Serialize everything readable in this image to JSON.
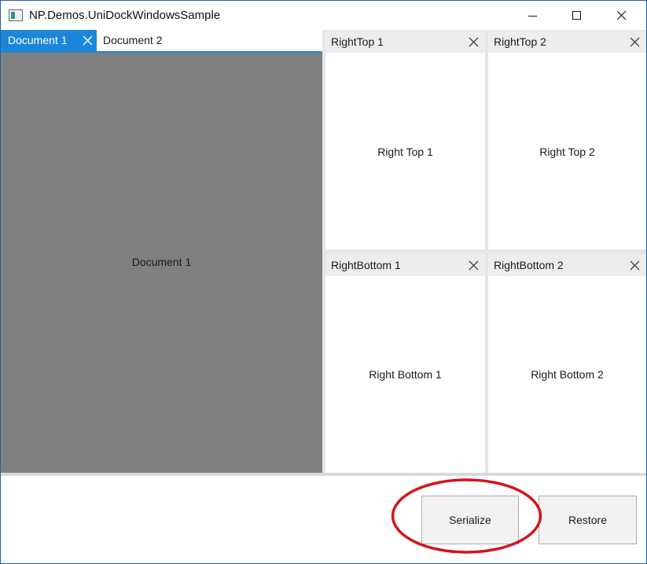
{
  "window": {
    "title": "NP.Demos.UniDockWindowsSample"
  },
  "documents": {
    "tabs": [
      {
        "label": "Document 1",
        "active": true
      },
      {
        "label": "Document 2",
        "active": false
      }
    ],
    "content_label": "Document 1"
  },
  "panes": {
    "right_top_1": {
      "title": "RightTop 1",
      "content": "Right Top 1"
    },
    "right_top_2": {
      "title": "RightTop 2",
      "content": "Right Top 2"
    },
    "right_bottom_1": {
      "title": "RightBottom 1",
      "content": "Right Bottom 1"
    },
    "right_bottom_2": {
      "title": "RightBottom 2",
      "content": "Right Bottom 2"
    }
  },
  "actions": {
    "serialize_label": "Serialize",
    "restore_label": "Restore"
  },
  "colors": {
    "accent": "#1c87d8",
    "document_background": "#808080",
    "annotation": "#d4141c"
  },
  "icons": [
    "app-icon",
    "minimize-icon",
    "maximize-icon",
    "close-icon"
  ]
}
